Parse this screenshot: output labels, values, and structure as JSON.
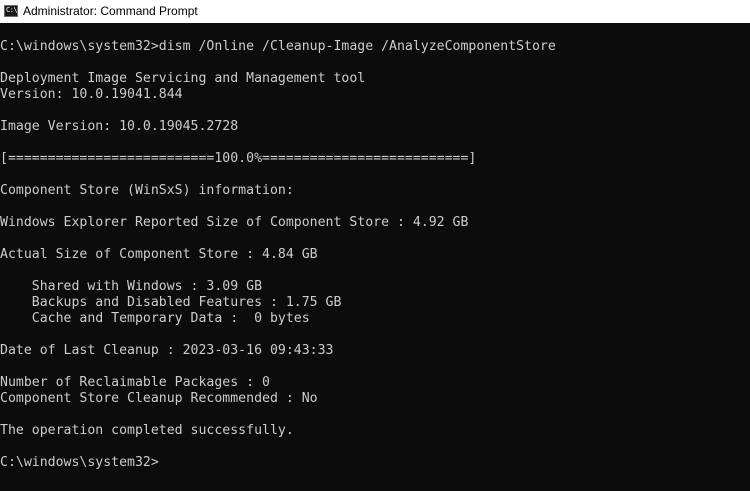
{
  "window": {
    "title": "Administrator: Command Prompt",
    "icon_name": "command-prompt-icon",
    "icon_glyph": "C:\\"
  },
  "console": {
    "lines": [
      "C:\\windows\\system32>dism /Online /Cleanup-Image /AnalyzeComponentStore",
      "",
      "Deployment Image Servicing and Management tool",
      "Version: 10.0.19041.844",
      "",
      "Image Version: 10.0.19045.2728",
      "",
      "[==========================100.0%==========================]",
      "",
      "Component Store (WinSxS) information:",
      "",
      "Windows Explorer Reported Size of Component Store : 4.92 GB",
      "",
      "Actual Size of Component Store : 4.84 GB",
      "",
      "    Shared with Windows : 3.09 GB",
      "    Backups and Disabled Features : 1.75 GB",
      "    Cache and Temporary Data :  0 bytes",
      "",
      "Date of Last Cleanup : 2023-03-16 09:43:33",
      "",
      "Number of Reclaimable Packages : 0",
      "Component Store Cleanup Recommended : No",
      "",
      "The operation completed successfully.",
      "",
      "C:\\windows\\system32>"
    ],
    "text_color": "#cccccc",
    "background_color": "#0c0c0c"
  }
}
